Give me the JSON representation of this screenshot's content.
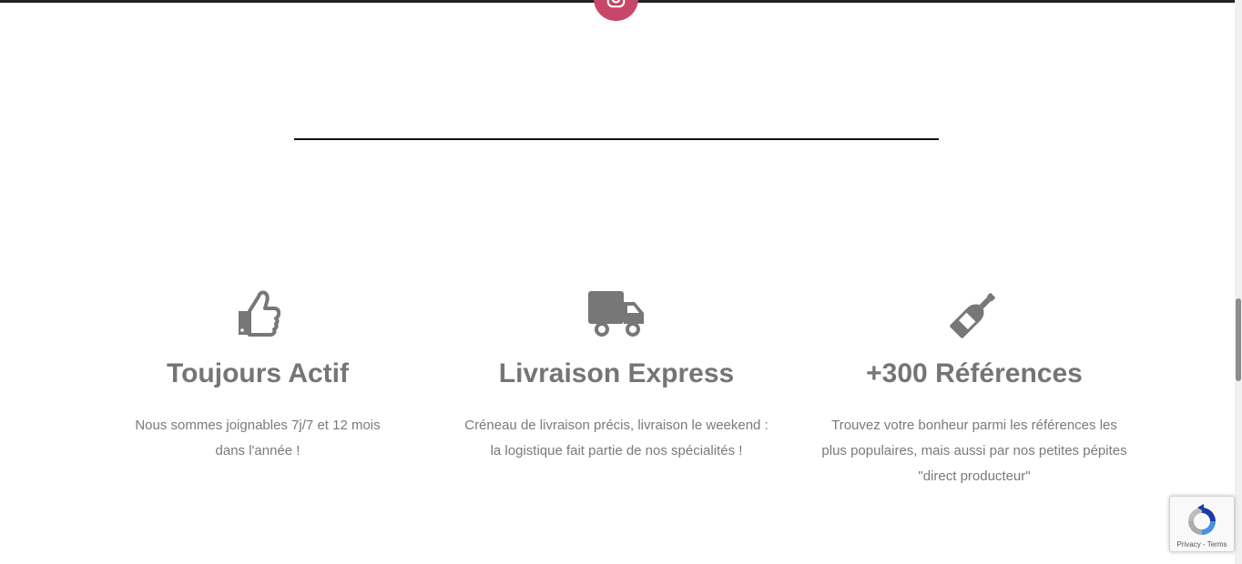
{
  "social": {
    "icon": "instagram-icon",
    "color": "#c8466a"
  },
  "features": [
    {
      "icon": "thumbs-up-icon",
      "title": "Toujours Actif",
      "text": "Nous sommes joignables 7j/7 et 12 mois dans l'année !"
    },
    {
      "icon": "truck-icon",
      "title": "Livraison Express",
      "text": "Créneau de livraison précis, livraison le weekend : la logistique fait partie de nos spécialités !"
    },
    {
      "icon": "wine-bottle-icon",
      "title": "+300 Références",
      "text": "Trouvez votre bonheur parmi les références les plus populaires, mais aussi par nos petites pépites \"direct producteur\""
    }
  ],
  "recaptcha": {
    "privacy": "Privacy",
    "separator": " - ",
    "terms": "Terms"
  },
  "colors": {
    "icon_gray": "#777777",
    "text_gray": "#7a7a7a",
    "divider": "#111111"
  }
}
